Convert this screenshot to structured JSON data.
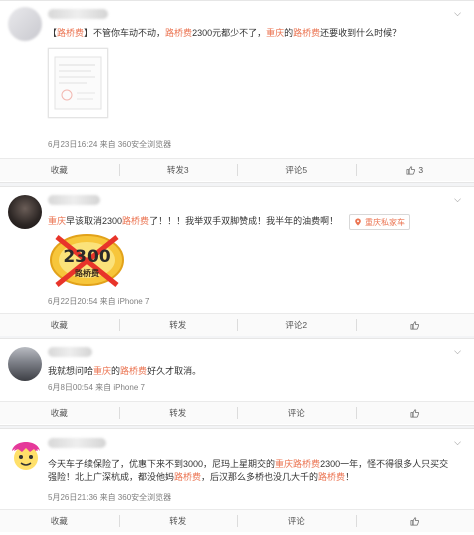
{
  "posts": [
    {
      "text_parts": [
        {
          "t": "【",
          "hl": false
        },
        {
          "t": "路桥费",
          "hl": true
        },
        {
          "t": "】不管你车动不动，",
          "hl": false
        },
        {
          "t": "路桥费",
          "hl": true
        },
        {
          "t": "2300元都少不了，",
          "hl": false
        },
        {
          "t": "重庆",
          "hl": true
        },
        {
          "t": "的",
          "hl": false
        },
        {
          "t": "路桥费",
          "hl": true
        },
        {
          "t": "还要收到什么时候？",
          "hl": false
        }
      ],
      "meta": "6月23日16:24 来自 360安全浏览器",
      "actions": {
        "collect": "收藏",
        "repost": "转发3",
        "comment": "评论5",
        "like": "3"
      }
    },
    {
      "text_parts": [
        {
          "t": "重庆",
          "hl": true
        },
        {
          "t": "早该取消2300",
          "hl": false
        },
        {
          "t": "路桥费",
          "hl": true
        },
        {
          "t": "了！！！我举双手双脚赞成！我半年的油费啊！",
          "hl": false
        }
      ],
      "topic_chip": "重庆私家车",
      "sticker_label": "2300",
      "sticker_sub": "路桥费",
      "meta": "6月22日20:54 来自 iPhone 7",
      "actions": {
        "collect": "收藏",
        "repost": "转发",
        "comment": "评论2",
        "like": ""
      }
    },
    {
      "text_parts": [
        {
          "t": "我就想问哈",
          "hl": false
        },
        {
          "t": "重庆",
          "hl": true
        },
        {
          "t": "的",
          "hl": false
        },
        {
          "t": "路桥费",
          "hl": true
        },
        {
          "t": "好久才取消。",
          "hl": false
        }
      ],
      "meta": "6月8日00:54 来自 iPhone 7",
      "actions": {
        "collect": "收藏",
        "repost": "转发",
        "comment": "评论",
        "like": ""
      }
    },
    {
      "text_parts": [
        {
          "t": "今天车子续保险了，优惠下来不到3000，尼玛上星期交的",
          "hl": false
        },
        {
          "t": "重庆",
          "hl": true
        },
        {
          "t": "路桥费",
          "hl": true
        },
        {
          "t": "2300一年，怪不得很多人只买交强险！北上广深杭成，都没他妈",
          "hl": false
        },
        {
          "t": "路桥费",
          "hl": true
        },
        {
          "t": "，后汉那么多桥也没几大千的",
          "hl": false
        },
        {
          "t": "路桥费",
          "hl": true
        },
        {
          "t": "！",
          "hl": false
        }
      ],
      "meta": "5月26日21:36 来自 360安全浏览器",
      "actions": {
        "collect": "收藏",
        "repost": "转发",
        "comment": "评论",
        "like": ""
      }
    }
  ],
  "colors": {
    "highlight": "#eb7350",
    "meta": "#808080"
  }
}
